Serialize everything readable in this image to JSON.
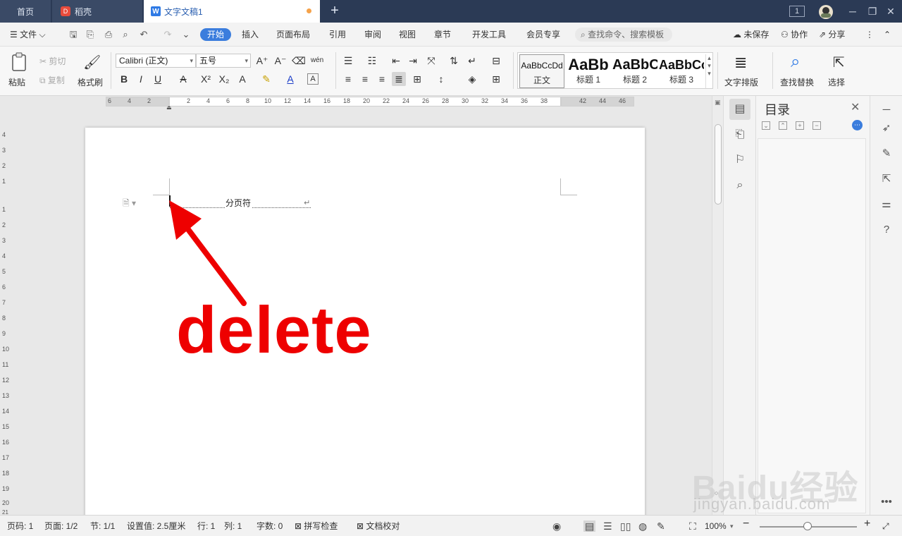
{
  "tabs": {
    "home": "首页",
    "daoke": "稻壳",
    "document": "文字文稿1",
    "doc_icon": "W"
  },
  "menu": {
    "file": "文件",
    "items": [
      "开始",
      "插入",
      "页面布局",
      "引用",
      "审阅",
      "视图",
      "章节",
      "开发工具",
      "会员专享"
    ],
    "search_placeholder": "查找命令、搜索模板",
    "unsaved": "未保存",
    "collaborate": "协作",
    "share": "分享"
  },
  "ribbon": {
    "paste": "粘贴",
    "cut": "剪切",
    "copy": "复制",
    "format_painter": "格式刷",
    "font_name": "Calibri (正文)",
    "font_size": "五号",
    "text_layout": "文字排版",
    "find_replace": "查找替换",
    "select": "选择",
    "styles": [
      {
        "sample": "AaBbCcDd",
        "name": "正文"
      },
      {
        "sample": "AaBb",
        "name": "标题 1"
      },
      {
        "sample": "AaBbC",
        "name": "标题 2"
      },
      {
        "sample": "AaBbCc",
        "name": "标题 3"
      }
    ]
  },
  "ruler": {
    "left_ticks": [
      "6",
      "4",
      "2"
    ],
    "ticks": [
      "2",
      "4",
      "6",
      "8",
      "10",
      "12",
      "14",
      "16",
      "18",
      "20",
      "22",
      "24",
      "26",
      "28",
      "30",
      "32",
      "34",
      "36",
      "38"
    ],
    "right_ticks": [
      "42",
      "44",
      "46"
    ],
    "vertical_ticks": [
      "4",
      "3",
      "2",
      "1",
      "1",
      "2",
      "3",
      "4",
      "5",
      "6",
      "7",
      "8",
      "9",
      "10",
      "11",
      "12",
      "13",
      "14",
      "15",
      "16",
      "17",
      "18",
      "19",
      "20",
      "21"
    ]
  },
  "document": {
    "page_break_label": "分页符",
    "paragraph_mark": "↵",
    "annotation_text": "delete",
    "annotation_color": "#ee0000"
  },
  "toc": {
    "title": "目录"
  },
  "status": {
    "page": "页码: 1",
    "pages": "页面: 1/2",
    "section": "节: 1/1",
    "setting": "设置值: 2.5厘米",
    "row": "行: 1",
    "column": "列: 1",
    "word_count": "字数: 0",
    "spell_check": "拼写检查",
    "proofread": "文档校对",
    "zoom": "100%"
  },
  "watermark": {
    "logo": "Baidu经验",
    "url": "jingyan.baidu.com"
  },
  "colors": {
    "tabbar": "#2b3a55",
    "accent": "#3b7ddd",
    "annotation": "#ee0000"
  }
}
